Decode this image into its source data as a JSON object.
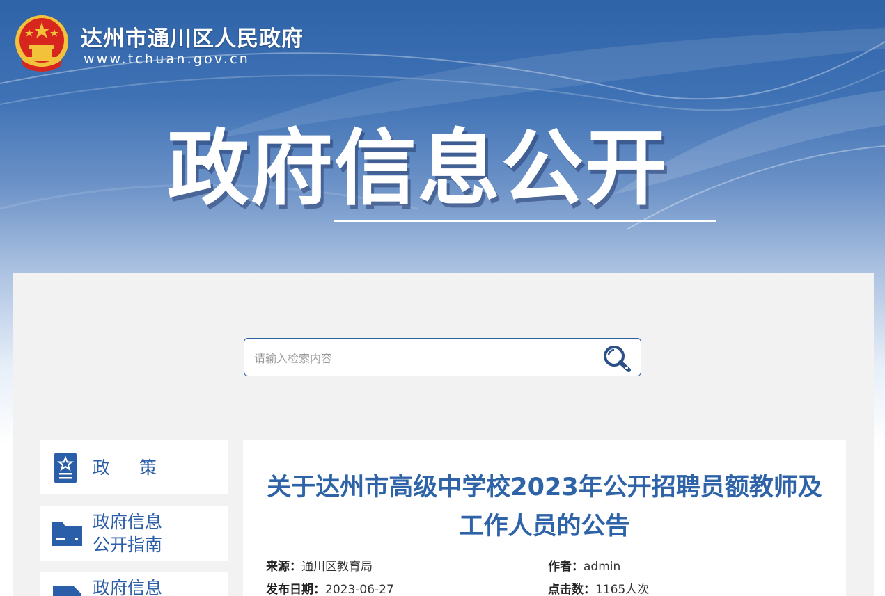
{
  "header": {
    "site_name": "达州市通川区人民政府",
    "site_url": "www.tchuan.gov.cn",
    "banner_title": "政府信息公开",
    "colors": {
      "primary_blue": "#2e63a8",
      "emblem_red": "#d7261e",
      "emblem_gold": "#f3c23b"
    }
  },
  "search": {
    "placeholder": "请输入检索内容",
    "icon": "magnifier-icon"
  },
  "sidebar": {
    "items": [
      {
        "label": "政策",
        "icon": "policy-doc-icon"
      },
      {
        "label_line1": "政府信息",
        "label_line2": "公开指南",
        "icon": "folder-icon"
      },
      {
        "label_line1": "政府信息",
        "icon": "document-icon"
      }
    ]
  },
  "article": {
    "title_line1": "关于达州市高级中学校2023年公开招聘员额教师及",
    "title_line2": "工作人员的公告",
    "meta": {
      "source_label": "来源",
      "source_value": "通川区教育局",
      "author_label": "作者",
      "author_value": "admin",
      "date_label": "发布日期",
      "date_value": "2023-06-27",
      "clicks_label": "点击数",
      "clicks_value": "1165人次",
      "colon": "："
    }
  }
}
